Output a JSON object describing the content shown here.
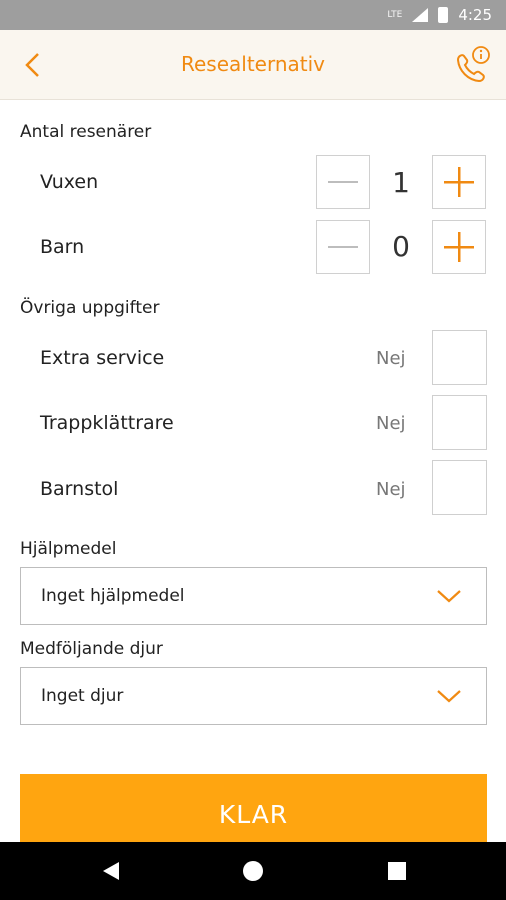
{
  "status_bar": {
    "network": "LTE",
    "time": "4:25"
  },
  "app_bar": {
    "title": "Resealternativ",
    "back_icon": "chevron-left-icon",
    "action_icon": "phone-info-icon",
    "accent": "#f08a12"
  },
  "passengers": {
    "section_label": "Antal resenärer",
    "rows": [
      {
        "label": "Vuxen",
        "count": "1",
        "minus_enabled": false,
        "plus_enabled": true
      },
      {
        "label": "Barn",
        "count": "0",
        "minus_enabled": false,
        "plus_enabled": true
      }
    ]
  },
  "other": {
    "section_label": "Övriga uppgifter",
    "rows": [
      {
        "label": "Extra service",
        "value": "Nej",
        "checked": false
      },
      {
        "label": "Trappklättrare",
        "value": "Nej",
        "checked": false
      },
      {
        "label": "Barnstol",
        "value": "Nej",
        "checked": false
      }
    ]
  },
  "aid": {
    "label": "Hjälpmedel",
    "selected": "Inget hjälpmedel"
  },
  "animal": {
    "label": "Medföljande djur",
    "selected": "Inget djur"
  },
  "done_button": {
    "label": "KLAR",
    "color": "#ffa510"
  },
  "nav_bar": {
    "back": "nav-back-icon",
    "home": "nav-home-icon",
    "recents": "nav-recents-icon"
  }
}
